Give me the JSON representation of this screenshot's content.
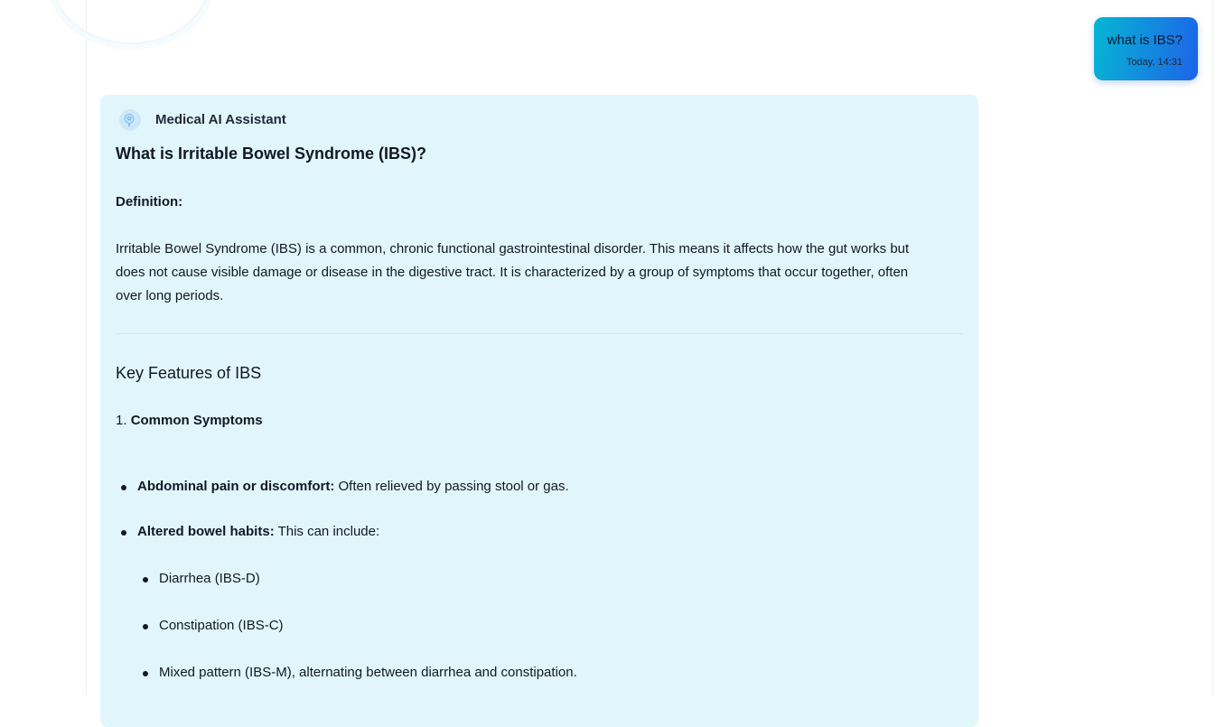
{
  "user_message": {
    "text": "what is IBS?",
    "timestamp": "Today, 14:31"
  },
  "assistant": {
    "name": "Medical AI Assistant",
    "avatar_icon": "brain-icon",
    "title": "What is Irritable Bowel Syndrome (IBS)?",
    "definition_label": "Definition:",
    "definition_lines": [
      "Irritable Bowel Syndrome (IBS) is a common, chronic functional gastrointestinal disorder. This means it affects how the gut works but",
      "does not cause visible damage or disease in the digestive tract. It is characterized by a group of symptoms that occur together, often",
      "over long periods."
    ],
    "section_title": "Key Features of IBS",
    "subsection": {
      "number": "1.",
      "label": "Common Symptoms"
    },
    "bullets": [
      {
        "bold": "Abdominal pain or discomfort:",
        "text": " Often relieved by passing stool or gas."
      },
      {
        "bold": "Altered bowel habits:",
        "text": " This can include:"
      }
    ],
    "sub_bullets": [
      "Diarrhea (IBS-D)",
      "Constipation (IBS-C)",
      "Mixed pattern (IBS-M), alternating between diarrhea and constipation."
    ]
  }
}
